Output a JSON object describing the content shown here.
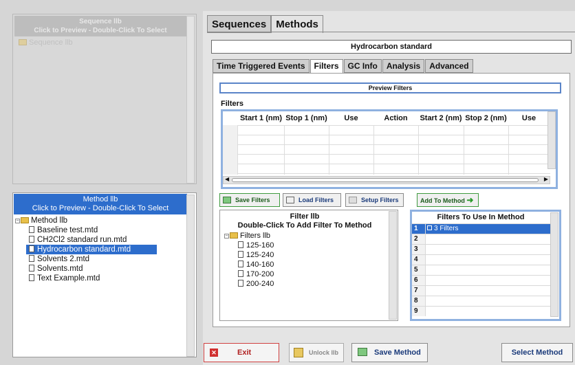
{
  "sequence_panel": {
    "header_line1": "Sequence llb",
    "header_line2": "Click to Preview - Double-Click To Select",
    "items": [
      "Sequence llb"
    ]
  },
  "method_panel": {
    "header_line1": "Method llb",
    "header_line2": "Click to Preview - Double-Click To Select",
    "root": "Method llb",
    "items": [
      "Baseline test.mtd",
      "CH2Cl2 standard run.mtd",
      "Hydrocarbon standard.mtd",
      "Solvents 2.mtd",
      "Solvents.mtd",
      "Text Example.mtd"
    ],
    "selected_index": 2
  },
  "main_tabs": [
    "Sequences",
    "Methods"
  ],
  "active_main_tab": 1,
  "method_title": "Hydrocarbon standard",
  "sub_tabs": [
    "Time Triggered Events",
    "Filters",
    "GC Info",
    "Analysis",
    "Advanced"
  ],
  "active_sub_tab": 1,
  "preview_filters_label": "Preview Filters",
  "filters_label": "Filters",
  "filters_grid": {
    "columns": [
      "Start 1 (nm)",
      "Stop 1 (nm)",
      "Use",
      "Action",
      "Start 2 (nm)",
      "Stop 2 (nm)",
      "Use"
    ]
  },
  "buttons": {
    "save_filters": "Save Filters",
    "load_filters": "Load Filters",
    "setup_filters": "Setup Filters",
    "add_to_method": "Add To Method",
    "exit": "Exit",
    "unlock": "Unlock llb",
    "save_method": "Save Method",
    "select_method": "Select Method"
  },
  "filter_lib": {
    "header_line1": "Filter llb",
    "header_line2": "Double-Click To Add Filter To Method",
    "root": "Filters llb",
    "items": [
      "125-160",
      "125-240",
      "140-160",
      "170-200",
      "200-240"
    ]
  },
  "filters_to_use": {
    "header": "Filters To Use In Method",
    "rows": [
      "1",
      "2",
      "3",
      "4",
      "5",
      "6",
      "7",
      "8",
      "9"
    ],
    "first_value": "3 Filters"
  },
  "colors": {
    "selection": "#2d6dcc",
    "grid_border": "#8fb1e0",
    "exit_border": "#d04040"
  }
}
